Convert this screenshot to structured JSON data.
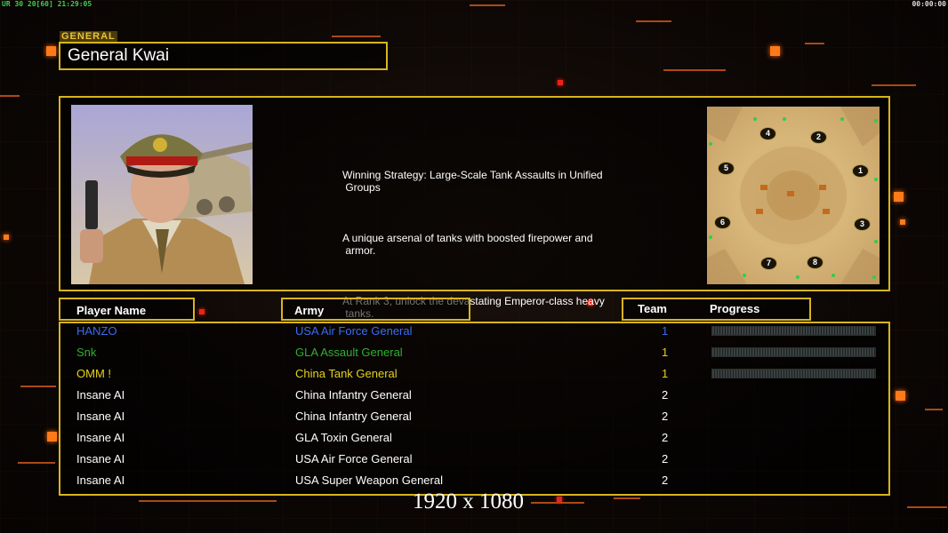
{
  "hud": {
    "left_stats": "UR 30 20[60] 21:29:05",
    "right_clock": "00:00:00"
  },
  "general": {
    "tag": "GENERAL",
    "name": "General Kwai"
  },
  "description": {
    "paragraphs": [
      "Winning Strategy: Large-Scale Tank Assaults in Unified\n Groups",
      "A unique arsenal of tanks with boosted firepower and\n armor.",
      "At Rank 3, unlock the devastating Emperor-class heavy\n tanks."
    ]
  },
  "minimap": {
    "start_positions": [
      "1",
      "2",
      "3",
      "4",
      "5",
      "6",
      "7",
      "8"
    ]
  },
  "table": {
    "headers": {
      "player_name": "Player Name",
      "army": "Army",
      "team": "Team",
      "progress": "Progress"
    },
    "rows": [
      {
        "name": "HANZO",
        "army": "USA Air Force General",
        "team": "1",
        "color": "#3a6cf0",
        "team_color": "#3a6cf0",
        "progress": 0
      },
      {
        "name": "Snk",
        "army": "GLA Assault General",
        "team": "1",
        "color": "#2fb02f",
        "team_color": "#e6d21e",
        "progress": 0
      },
      {
        "name": "OMM !",
        "army": "China Tank General",
        "team": "1",
        "color": "#e6d21e",
        "team_color": "#e6d21e",
        "progress": 0
      },
      {
        "name": "Insane AI",
        "army": "China Infantry General",
        "team": "2",
        "color": "#ffffff",
        "team_color": "#ffffff",
        "progress": null
      },
      {
        "name": "Insane AI",
        "army": "China Infantry General",
        "team": "2",
        "color": "#ffffff",
        "team_color": "#ffffff",
        "progress": null
      },
      {
        "name": "Insane AI",
        "army": "GLA Toxin General",
        "team": "2",
        "color": "#ffffff",
        "team_color": "#ffffff",
        "progress": null
      },
      {
        "name": "Insane AI",
        "army": "USA Air Force General",
        "team": "2",
        "color": "#ffffff",
        "team_color": "#ffffff",
        "progress": null
      },
      {
        "name": "Insane AI",
        "army": "USA Super Weapon General",
        "team": "2",
        "color": "#ffffff",
        "team_color": "#ffffff",
        "progress": null
      }
    ]
  },
  "resolution_label": "1920 x 1080",
  "colors": {
    "frame_gold": "#d8b41e",
    "accent_orange": "#ff7a1a"
  }
}
